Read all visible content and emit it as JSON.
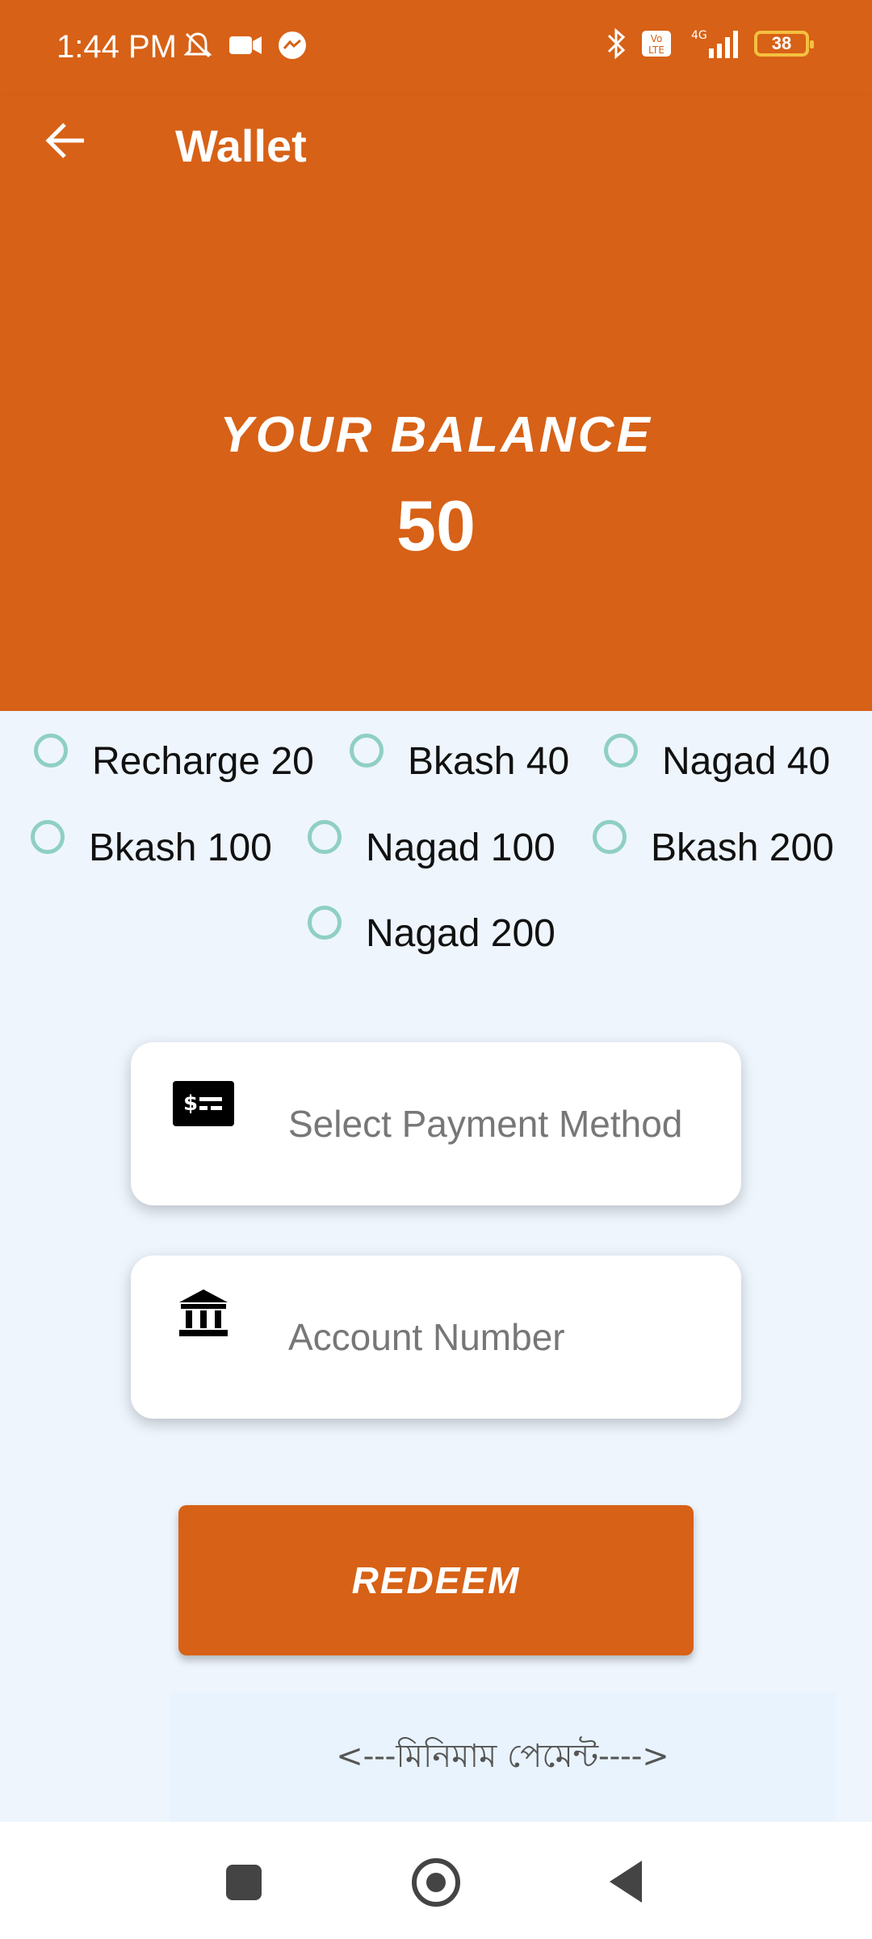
{
  "status_bar": {
    "time": "1:44 PM",
    "battery": "38",
    "network": "4G"
  },
  "appbar": {
    "title": "Wallet",
    "back_icon": "arrow-left-icon"
  },
  "balance": {
    "label": "YOUR BALANCE",
    "amount": "50"
  },
  "options": [
    {
      "label": "Recharge 20"
    },
    {
      "label": "Bkash 40"
    },
    {
      "label": "Nagad 40"
    },
    {
      "label": "Bkash 100"
    },
    {
      "label": "Nagad 100"
    },
    {
      "label": "Bkash 200"
    },
    {
      "label": "Nagad 200"
    }
  ],
  "payment_method": {
    "placeholder": "Select Payment Method",
    "icon": "money-card-icon"
  },
  "account_number": {
    "placeholder": "Account Number",
    "icon": "bank-icon"
  },
  "redeem_button": {
    "label": "REDEEM"
  },
  "minimum_payment": {
    "text": "<---মিনিমাম পেমেন্ট---->"
  },
  "colors": {
    "accent": "#d76116",
    "background": "#eef5fd",
    "radio": "#8fcfc4"
  }
}
